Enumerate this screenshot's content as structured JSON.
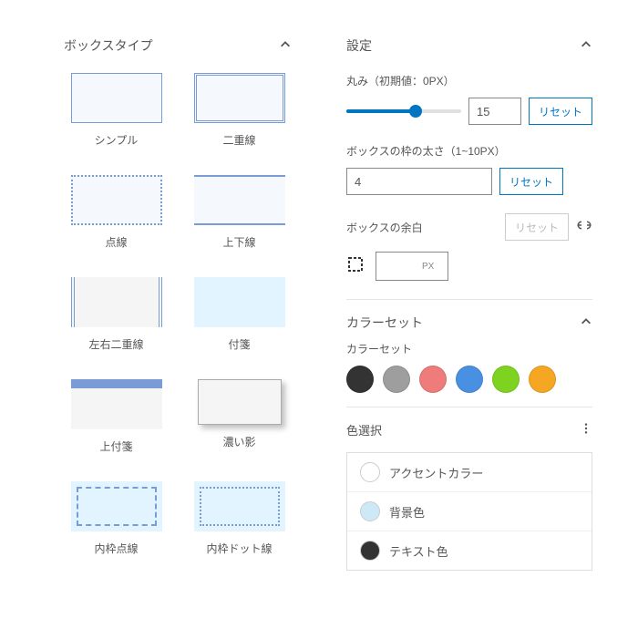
{
  "left": {
    "title": "ボックスタイプ",
    "items": [
      {
        "label": "シンプル"
      },
      {
        "label": "二重線"
      },
      {
        "label": "点線"
      },
      {
        "label": "上下線"
      },
      {
        "label": "左右二重線"
      },
      {
        "label": "付箋"
      },
      {
        "label": "上付箋"
      },
      {
        "label": "濃い影"
      },
      {
        "label": "内枠点線"
      },
      {
        "label": "内枠ドット線"
      }
    ]
  },
  "right": {
    "settings_title": "設定",
    "radius_label": "丸み（初期値：0PX）",
    "radius_value": "15",
    "reset_label": "リセット",
    "thickness_label": "ボックスの枠の太さ（1~10PX）",
    "thickness_value": "4",
    "margin_label": "ボックスの余白",
    "margin_unit": "PX",
    "colorset_title": "カラーセット",
    "colorset_label": "カラーセット",
    "swatches": [
      "#333333",
      "#9e9e9e",
      "#ef7b7b",
      "#4a90e2",
      "#7ed321",
      "#f5a623"
    ],
    "colorselect_title": "色選択",
    "colors": [
      {
        "label": "アクセントカラー",
        "value": "#ffffff"
      },
      {
        "label": "背景色",
        "value": "#cde9f7"
      },
      {
        "label": "テキスト色",
        "value": "#333333"
      }
    ]
  }
}
